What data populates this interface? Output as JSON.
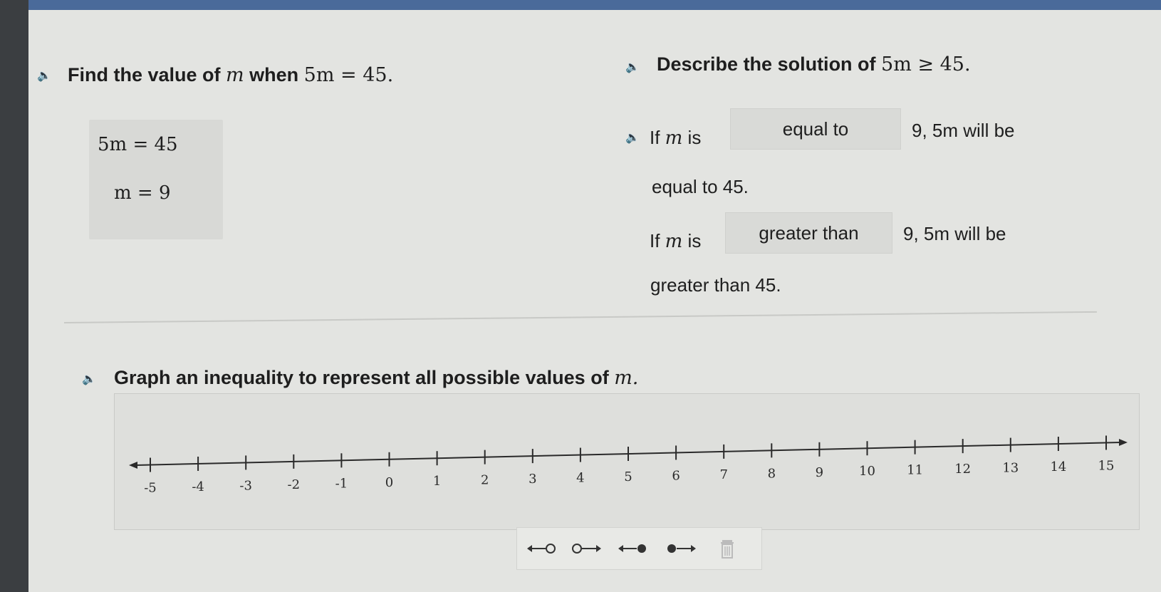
{
  "q1": {
    "speaker_icon": "speaker-icon",
    "prefix": "Find the value of ",
    "var": "m",
    "mid": " when ",
    "equation": "5m = 45."
  },
  "q2": {
    "speaker_icon": "speaker-icon",
    "prefix": "Describe the solution of ",
    "inequality": "5m ≥ 45."
  },
  "work": {
    "line1": "5m = 45",
    "line2": "m = 9"
  },
  "sentence1": {
    "lead": "If ",
    "var": "m",
    "is": " is",
    "dropdown": "equal to",
    "tail": "9, 5m will be",
    "line2": "equal to 45."
  },
  "sentence2": {
    "lead": "If ",
    "var": "m",
    "is": " is",
    "dropdown": "greater than",
    "tail": "9, 5m will be",
    "line2": "greater than 45."
  },
  "q3": {
    "text": "Graph an inequality to represent all possible values of ",
    "var": "m."
  },
  "number_line": {
    "ticks": [
      "-5",
      "-4",
      "-3",
      "-2",
      "-1",
      "0",
      "1",
      "2",
      "3",
      "4",
      "5",
      "6",
      "7",
      "8",
      "9",
      "10",
      "11",
      "12",
      "13",
      "14",
      "15"
    ]
  },
  "tools": [
    "open-circle-left-arrow-icon",
    "open-circle-right-arrow-icon",
    "closed-circle-left-arrow-icon",
    "closed-circle-right-arrow-icon",
    "trash-icon"
  ],
  "colors": {
    "page_bg": "#e3e4e1",
    "box_bg": "#d8d9d6",
    "text": "#1e1e1e"
  }
}
